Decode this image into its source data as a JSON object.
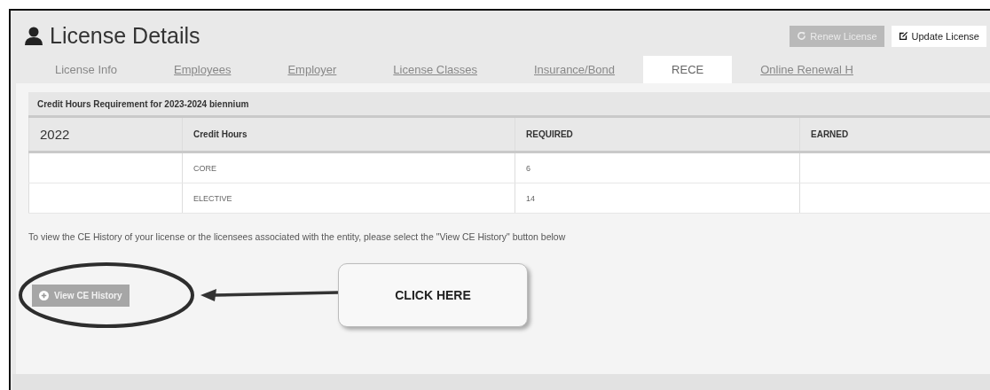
{
  "header": {
    "title": "License Details",
    "actions": [
      {
        "label": "Renew License",
        "kind": "renew",
        "disabled": true
      },
      {
        "label": "Update License",
        "kind": "edit",
        "disabled": false
      }
    ]
  },
  "tabs": [
    {
      "label": "License Info",
      "selected": false,
      "underlined": false
    },
    {
      "label": "Employees",
      "selected": false,
      "underlined": true
    },
    {
      "label": "Employer",
      "selected": false,
      "underlined": true
    },
    {
      "label": "License Classes",
      "selected": false,
      "underlined": true
    },
    {
      "label": "Insurance/Bond",
      "selected": false,
      "underlined": true
    },
    {
      "label": "RECE",
      "selected": true,
      "underlined": false
    },
    {
      "label": "Online Renewal H",
      "selected": false,
      "underlined": true
    }
  ],
  "table": {
    "caption": "Credit Hours Requirement for 2023-2024 biennium",
    "columns": [
      "2022",
      "Credit Hours",
      "REQUIRED",
      "EARNED"
    ],
    "rows": [
      [
        "",
        "CORE",
        "6",
        ""
      ],
      [
        "",
        "ELECTIVE",
        "14",
        ""
      ]
    ]
  },
  "note": "To view the CE History of your license or the licensees associated with the entity, please select the \"View CE History\" button below",
  "history_button": {
    "label": "View CE History",
    "disabled": true
  },
  "callout": {
    "text": "CLICK HERE"
  }
}
